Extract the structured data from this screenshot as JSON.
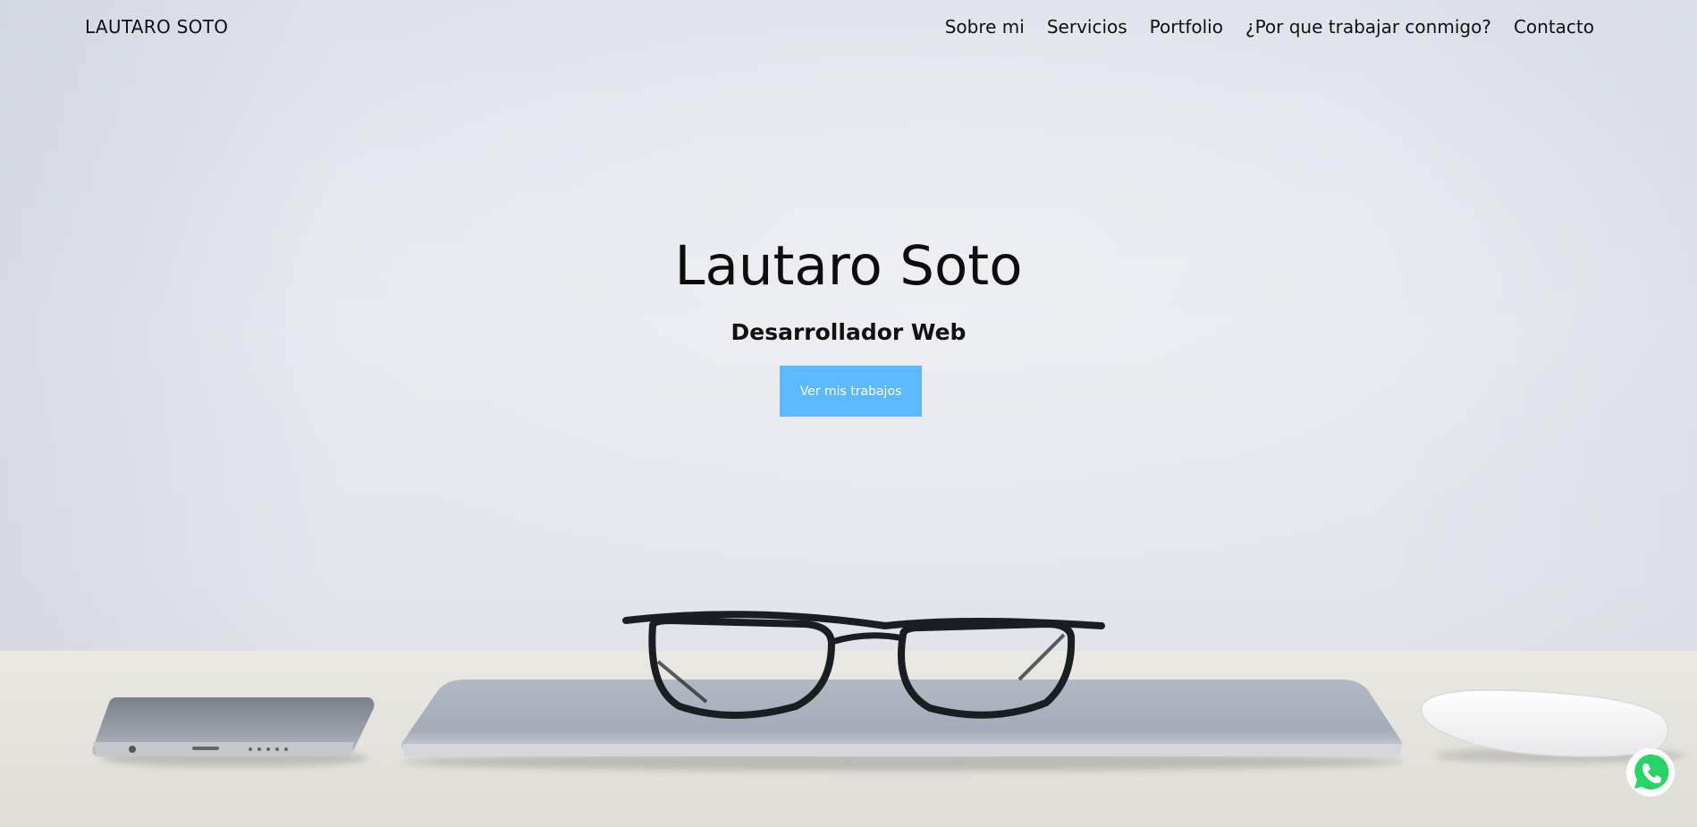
{
  "nav": {
    "brand": "LAUTARO SOTO",
    "items": [
      {
        "label": "Sobre mi"
      },
      {
        "label": "Servicios"
      },
      {
        "label": "Portfolio"
      },
      {
        "label": "¿Por que trabajar conmigo?"
      },
      {
        "label": "Contacto"
      }
    ]
  },
  "hero": {
    "title": "Lautaro Soto",
    "subtitle": "Desarrollador Web",
    "cta_label": "Ver mis trabajos"
  },
  "colors": {
    "cta": "#5cb8ff",
    "whatsapp": "#25d366",
    "text": "#111111"
  },
  "icons": {
    "floating_button": "whatsapp-icon"
  }
}
